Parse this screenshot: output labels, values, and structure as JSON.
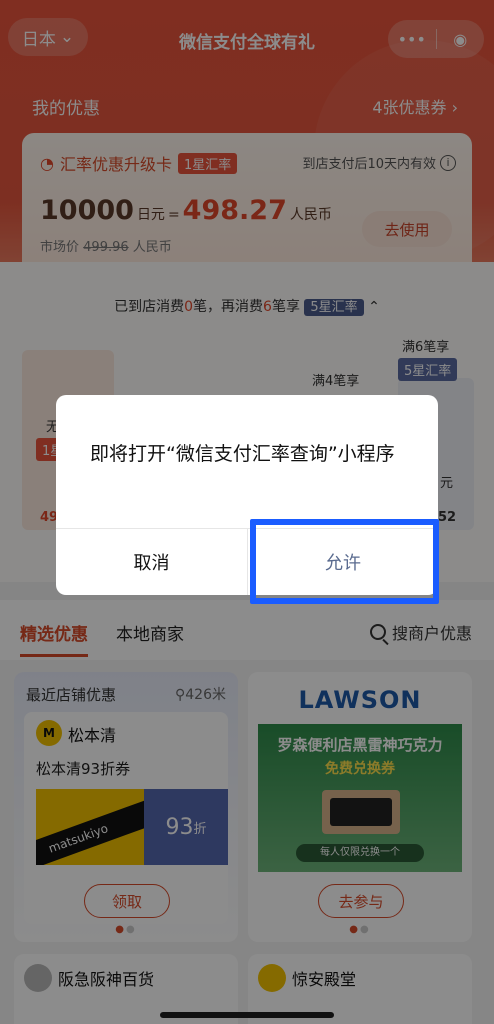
{
  "header": {
    "region": "日本",
    "title": "微信支付全球有礼",
    "menu_icon": "more-dots-icon",
    "close_icon": "target-icon"
  },
  "offers": {
    "label": "我的优惠",
    "count": "4张优惠券",
    "card": {
      "name": "汇率优惠升级卡",
      "tag": "1星汇率",
      "validity": "到店支付后10天内有效",
      "jpy_amount": "10000",
      "jpy_unit": "日元",
      "equals": "=",
      "rmb_amount": "498.27",
      "rmb_unit": "人民币",
      "market_label": "市场价",
      "market_price": "499.96",
      "market_unit": "人民币",
      "use_button": "去使用"
    }
  },
  "progress": {
    "prefix": "已到店消费",
    "done": "0",
    "mid": "笔，再消费",
    "remaining": "6",
    "suffix": "笔享",
    "target_tag": "5星汇率",
    "tier1": "满4笔享",
    "tier2": "满6笔享",
    "tier2_tag": "5星汇率",
    "partial_left_text": "无",
    "partial_left_tag": "1星",
    "partial_right_text": "元",
    "left_value": "49",
    "right_value": "52"
  },
  "dialog": {
    "message": "即将打开“微信支付汇率查询”小程序",
    "cancel": "取消",
    "allow": "允许"
  },
  "tabs": {
    "featured": "精选优惠",
    "local": "本地商家",
    "search": "搜商户优惠"
  },
  "deals": {
    "nearest_label": "最近店铺优惠",
    "distance": "426米",
    "store1": {
      "name": "松本清",
      "coupon": "松本清93折券",
      "value": "93",
      "value_unit": "折",
      "button": "领取"
    },
    "store2": {
      "logo": "LAWSON",
      "line1": "罗森便利店黑雷神巧克力",
      "line2": "免费兑换券",
      "limit": "每人仅限兑换一个",
      "button": "去参与"
    },
    "store3": {
      "name": "阪急阪神百货"
    },
    "store4": {
      "name": "惊安殿堂"
    }
  }
}
